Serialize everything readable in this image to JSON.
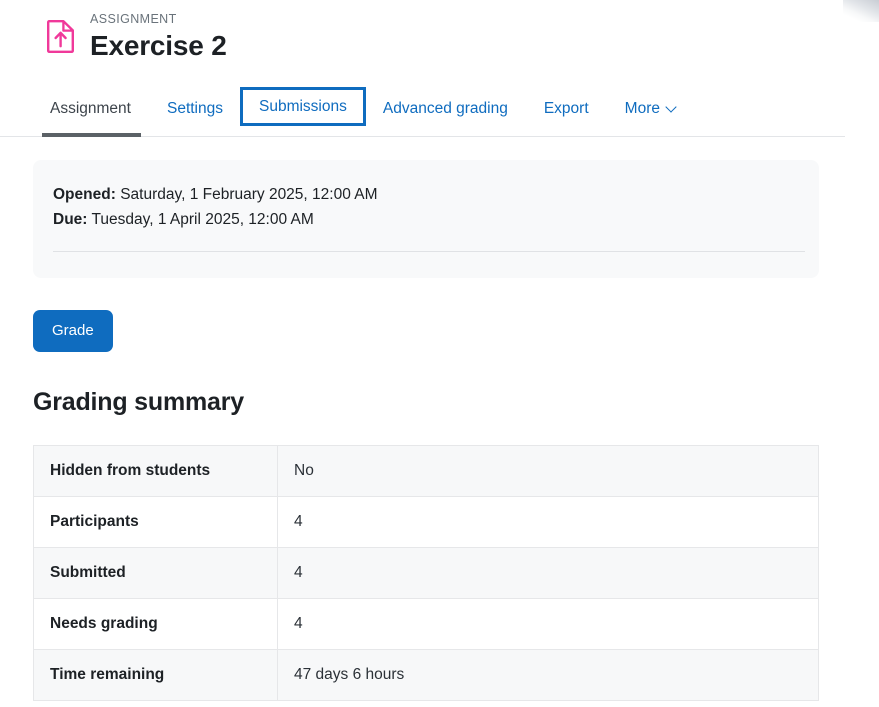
{
  "header": {
    "icon": "assignment-upload-icon",
    "icon_color": "#f0399a",
    "eyebrow": "ASSIGNMENT",
    "title": "Exercise 2"
  },
  "tabs": {
    "items": [
      {
        "label": "Assignment",
        "state": "active"
      },
      {
        "label": "Settings",
        "state": "default"
      },
      {
        "label": "Submissions",
        "state": "focused"
      },
      {
        "label": "Advanced grading",
        "state": "default"
      },
      {
        "label": "Export",
        "state": "default"
      },
      {
        "label": "More",
        "state": "default",
        "icon": "chevron-down-icon"
      }
    ],
    "active_color": "#3d444b",
    "link_color": "#0f6cbf",
    "focus_ring_color": "#0f6cbf"
  },
  "dates_panel": {
    "opened_label": "Opened:",
    "opened_value": "Saturday, 1 February 2025, 12:00 AM",
    "due_label": "Due:",
    "due_value": "Tuesday, 1 April 2025, 12:00 AM"
  },
  "actions": {
    "grade_label": "Grade",
    "grade_color": "#0f6cbf"
  },
  "grading_summary": {
    "title": "Grading summary",
    "rows": [
      {
        "label": "Hidden from students",
        "value": "No"
      },
      {
        "label": "Participants",
        "value": "4"
      },
      {
        "label": "Submitted",
        "value": "4"
      },
      {
        "label": "Needs grading",
        "value": "4"
      },
      {
        "label": "Time remaining",
        "value": "47 days 6 hours"
      }
    ]
  }
}
